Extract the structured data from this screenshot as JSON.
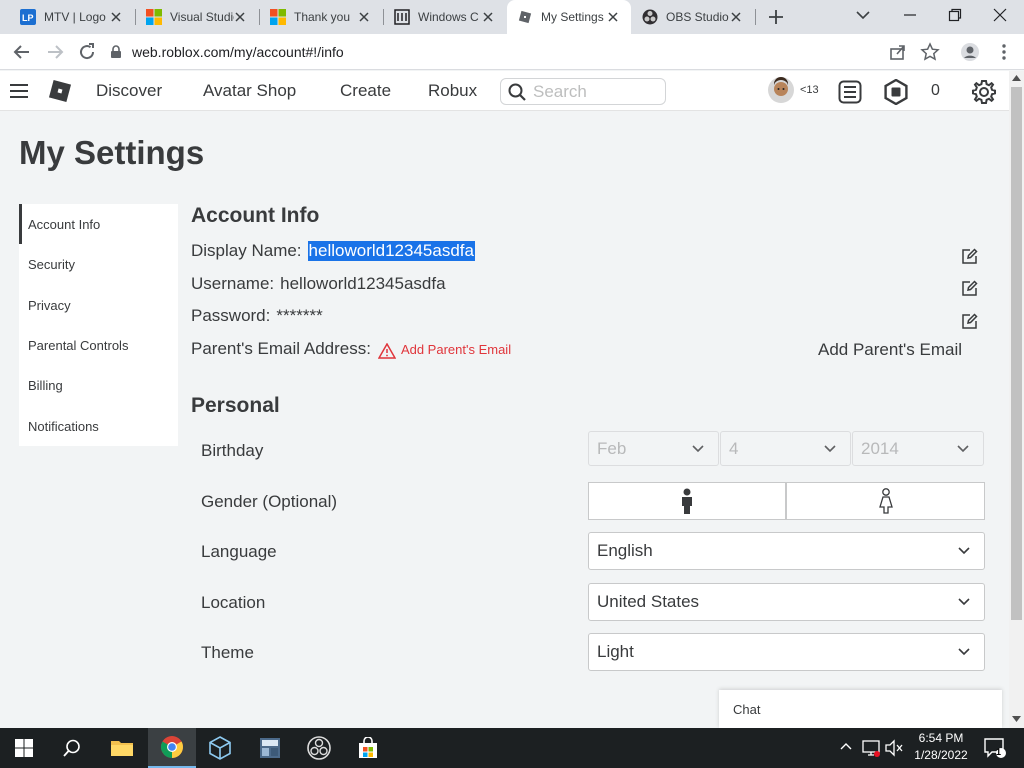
{
  "browser": {
    "tabs": [
      {
        "title": "MTV | Logo",
        "icon": "lp-icon"
      },
      {
        "title": "Visual Studio",
        "icon": "microsoft-icon"
      },
      {
        "title": "Thank you",
        "icon": "microsoft-icon"
      },
      {
        "title": "Windows C",
        "icon": "building-icon"
      },
      {
        "title": "My Settings",
        "icon": "roblox-icon"
      },
      {
        "title": "OBS Studio",
        "icon": "obs-icon"
      }
    ],
    "url": "web.roblox.com/my/account#!/info"
  },
  "header": {
    "nav": [
      "Discover",
      "Avatar Shop",
      "Create",
      "Robux"
    ],
    "search_placeholder": "Search",
    "age_label": "<13",
    "robux_count": "0"
  },
  "page": {
    "title": "My Settings"
  },
  "sidebar": {
    "items": [
      "Account Info",
      "Security",
      "Privacy",
      "Parental Controls",
      "Billing",
      "Notifications"
    ],
    "active": "Account Info"
  },
  "account_info": {
    "heading": "Account Info",
    "display_name_label": "Display Name:",
    "display_name_value": "helloworld12345asdfa",
    "username_label": "Username:",
    "username_value": "helloworld12345asdfa",
    "password_label": "Password:",
    "password_value": "*******",
    "parent_email_label": "Parent's Email Address:",
    "parent_email_link": "Add Parent's Email",
    "parent_email_button": "Add Parent's Email"
  },
  "personal": {
    "heading": "Personal",
    "birthday_label": "Birthday",
    "birthday_month": "Feb",
    "birthday_day": "4",
    "birthday_year": "2014",
    "gender_label": "Gender (Optional)",
    "language_label": "Language",
    "language_value": "English",
    "location_label": "Location",
    "location_value": "United States",
    "theme_label": "Theme",
    "theme_value": "Light"
  },
  "chat": {
    "label": "Chat"
  },
  "taskbar": {
    "time": "6:54 PM",
    "date": "1/28/2022",
    "notification_count": "1"
  },
  "colors": {
    "warning_red": "#e0353b",
    "highlight_blue": "#1a73e8",
    "taskbar": "#1c2022"
  }
}
